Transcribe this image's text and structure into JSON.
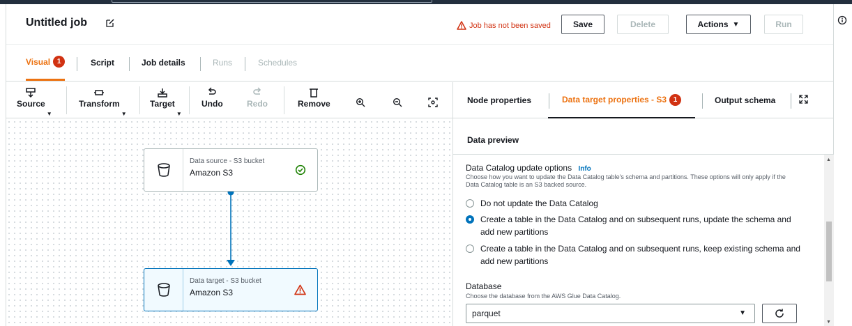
{
  "header": {
    "job_title": "Untitled job",
    "warning": "Job has not been saved",
    "save_label": "Save",
    "delete_label": "Delete",
    "actions_label": "Actions",
    "run_label": "Run"
  },
  "tabs": [
    {
      "label": "Visual",
      "badge": "1",
      "state": "active"
    },
    {
      "label": "Script",
      "state": "enabled"
    },
    {
      "label": "Job details",
      "state": "enabled"
    },
    {
      "label": "Runs",
      "state": "disabled"
    },
    {
      "label": "Schedules",
      "state": "disabled"
    }
  ],
  "toolbar": {
    "source": "Source",
    "transform": "Transform",
    "target": "Target",
    "undo": "Undo",
    "redo": "Redo",
    "remove": "Remove"
  },
  "nodes": {
    "source": {
      "type": "Data source - S3 bucket",
      "name": "Amazon S3",
      "status": "success"
    },
    "target": {
      "type": "Data target - S3 bucket",
      "name": "Amazon S3",
      "status": "warning"
    }
  },
  "panel": {
    "tabs": {
      "node_properties": "Node properties",
      "data_target": "Data target properties - S3",
      "data_target_badge": "1",
      "output_schema": "Output schema"
    },
    "data_preview": "Data preview",
    "catalog_update": {
      "title": "Data Catalog update options",
      "info": "Info",
      "description": "Choose how you want to update the Data Catalog table's schema and partitions. These options will only apply if the Data Catalog table is an S3 backed source.",
      "options": [
        {
          "label": "Do not update the Data Catalog",
          "selected": false
        },
        {
          "label": "Create a table in the Data Catalog and on subsequent runs, update the schema and add new partitions",
          "selected": true
        },
        {
          "label": "Create a table in the Data Catalog and on subsequent runs, keep existing schema and add new partitions",
          "selected": false
        }
      ]
    },
    "database": {
      "title": "Database",
      "description": "Choose the database from the AWS Glue Data Catalog.",
      "value": "parquet"
    }
  },
  "colors": {
    "accent": "#ec7211",
    "error": "#d13212",
    "link": "#0073bb",
    "success": "#1d8102"
  }
}
